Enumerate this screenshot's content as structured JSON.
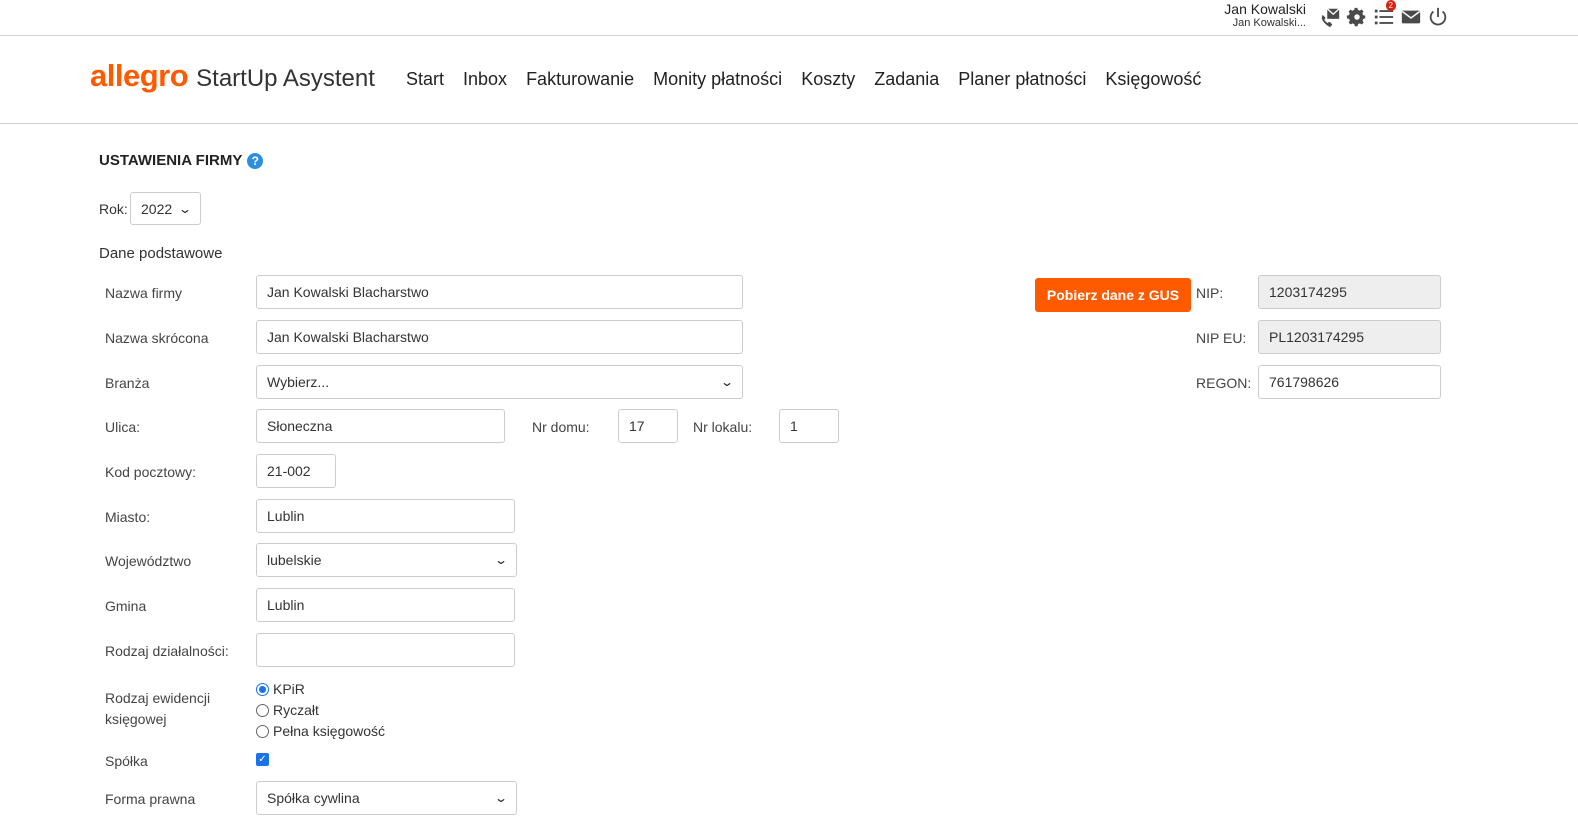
{
  "topbar": {
    "user_name": "Jan Kowalski",
    "user_sub": "Jan Kowalski...",
    "icons": [
      "phone-mail-icon",
      "gear-icon",
      "task-list-icon",
      "mail-icon",
      "power-icon"
    ],
    "task_badge": "2"
  },
  "logo": {
    "brand": "allegro",
    "suffix": "StartUp Asystent"
  },
  "nav": [
    "Start",
    "Inbox",
    "Fakturowanie",
    "Monity płatności",
    "Koszty",
    "Zadania",
    "Planer płatności",
    "Księgowość"
  ],
  "page": {
    "title": "USTAWIENIA FIRMY",
    "help": "?"
  },
  "year": {
    "label": "Rok:",
    "value": "2022"
  },
  "section": "Dane podstawowe",
  "form": {
    "company_name": {
      "label": "Nazwa firmy",
      "value": "Jan Kowalski Blacharstwo"
    },
    "short_name": {
      "label": "Nazwa skrócona",
      "value": "Jan Kowalski Blacharstwo"
    },
    "industry": {
      "label": "Branża",
      "value": "Wybierz..."
    },
    "street": {
      "label": "Ulica:",
      "value": "Słoneczna"
    },
    "house_no": {
      "label": "Nr domu:",
      "value": "17"
    },
    "flat_no": {
      "label": "Nr lokalu:",
      "value": "1"
    },
    "postal": {
      "label": "Kod pocztowy:",
      "value": "21-002"
    },
    "city": {
      "label": "Miasto:",
      "value": "Lublin"
    },
    "voivodeship": {
      "label": "Województwo",
      "value": "lubelskie"
    },
    "commune": {
      "label": "Gmina",
      "value": "Lublin"
    },
    "activity": {
      "label": "Rodzaj działalności:",
      "value": ""
    },
    "accounting": {
      "label1": "Rodzaj ewidencji",
      "label2": "księgowej",
      "options": [
        "KPiR",
        "Ryczałt",
        "Pełna księgowość"
      ],
      "selected": "KPiR"
    },
    "company": {
      "label": "Spółka",
      "checked": true
    },
    "legal_form": {
      "label": "Forma prawna",
      "value": "Spółka cywlina"
    }
  },
  "right": {
    "gus_button": "Pobierz dane z GUS",
    "nip": {
      "label": "NIP:",
      "value": "1203174295"
    },
    "nip_eu": {
      "label": "NIP EU:",
      "value": "PL1203174295"
    },
    "regon": {
      "label": "REGON:",
      "value": "761798626"
    }
  },
  "colors": {
    "accent": "#ff5a00",
    "link_blue": "#2d8fe0"
  }
}
